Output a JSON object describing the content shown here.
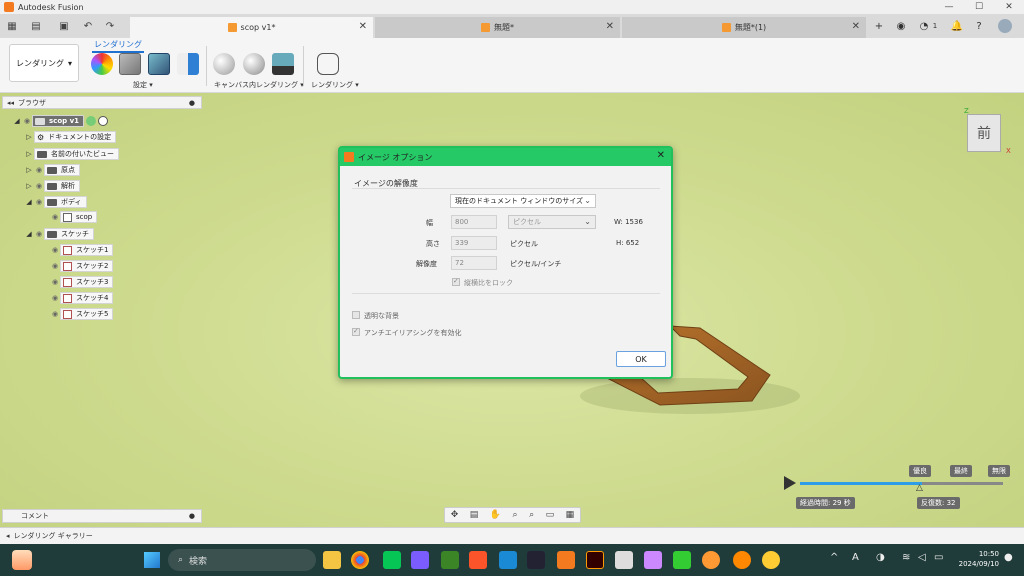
{
  "window": {
    "title": "Autodesk Fusion"
  },
  "tabs": [
    {
      "label": "scop v1*",
      "active": true
    },
    {
      "label": "無題*",
      "active": false
    },
    {
      "label": "無題*(1)",
      "active": false
    }
  ],
  "header": {
    "notification_count": "1"
  },
  "toolbar": {
    "workspace": "レンダリング",
    "ribbon_tab": "レンダリング",
    "groups": {
      "settings": "設定",
      "canvas_render": "キャンバス内レンダリング",
      "render": "レンダリング"
    }
  },
  "browser": {
    "title": "ブラウザ",
    "root": "scop v1",
    "items": {
      "doc_settings": "ドキュメントの設定",
      "named_views": "名前の付いたビュー",
      "origin": "原点",
      "analysis": "解析",
      "bodies": "ボディ",
      "body_scop": "scop",
      "sketches": "スケッチ",
      "sketch1": "スケッチ1",
      "sketch2": "スケッチ2",
      "sketch3": "スケッチ3",
      "sketch4": "スケッチ4",
      "sketch5": "スケッチ5"
    }
  },
  "dialog": {
    "title": "イメージ オプション",
    "section": "イメージの解像度",
    "size_preset": "現在のドキュメント ウィンドウのサイズ",
    "width_label": "幅",
    "width_value": "800",
    "width_unit": "ピクセル",
    "width_px": "W: 1536",
    "height_label": "高さ",
    "height_value": "339",
    "height_unit": "ピクセル",
    "height_px": "H: 652",
    "resolution_label": "解像度",
    "resolution_value": "72",
    "resolution_unit": "ピクセル/インチ",
    "lock_aspect": "縦横比をロック",
    "transparent_bg": "透明な背景",
    "antialiasing": "アンチエイリアシングを有効化",
    "ok": "OK"
  },
  "comments": {
    "label": "コメント"
  },
  "gallery": {
    "label": "レンダリング ギャラリー"
  },
  "render_progress": {
    "quality_labels": [
      "優良",
      "最終",
      "無限"
    ],
    "elapsed": "経過時間: 29 秒",
    "iterations": "反復数: 32",
    "progress_fraction": 0.6
  },
  "viewcube": {
    "face": "前",
    "axis_z": "Z",
    "axis_x": "X"
  },
  "taskbar": {
    "search_placeholder": "検索",
    "time": "10:50",
    "date": "2024/09/10"
  },
  "colors": {
    "dialog_accent": "#25c966",
    "canvas": "#cfdc91",
    "tab_active_accent": "#1f6fd0"
  }
}
